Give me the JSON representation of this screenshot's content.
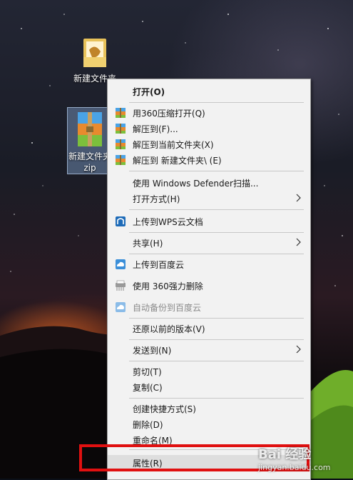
{
  "desktop": {
    "icons": [
      {
        "label": "新建文件夹",
        "icon": "folder-icon"
      },
      {
        "label": "新建文件夹",
        "label2": "zip",
        "icon": "winrar-archive-icon"
      }
    ]
  },
  "menu": {
    "items": [
      {
        "label": "打开(O)",
        "bold": true
      },
      {
        "label": "用360压缩打开(Q)",
        "icon": "archive-icon"
      },
      {
        "label": "解压到(F)...",
        "icon": "archive-icon"
      },
      {
        "label": "解压到当前文件夹(X)",
        "icon": "archive-icon"
      },
      {
        "label": "解压到 新建文件夹\\ (E)",
        "icon": "archive-icon"
      },
      {
        "label": "使用 Windows Defender扫描..."
      },
      {
        "label": "打开方式(H)",
        "submenu": true
      },
      {
        "label": "上传到WPS云文档",
        "icon": "wps-cloud-icon"
      },
      {
        "label": "共享(H)",
        "submenu": true
      },
      {
        "label": "上传到百度云",
        "icon": "baidu-cloud-icon"
      },
      {
        "label": "使用 360强力删除",
        "icon": "shredder-icon"
      },
      {
        "label": "自动备份到百度云",
        "icon": "baidu-cloud-icon",
        "disabled": true
      },
      {
        "label": "还原以前的版本(V)"
      },
      {
        "label": "发送到(N)",
        "submenu": true
      },
      {
        "label": "剪切(T)"
      },
      {
        "label": "复制(C)"
      },
      {
        "label": "创建快捷方式(S)"
      },
      {
        "label": "删除(D)"
      },
      {
        "label": "重命名(M)"
      },
      {
        "label": "属性(R)",
        "highlighted": true
      }
    ]
  },
  "watermark": {
    "text": "Bai 经验",
    "sub": "jingyan.baidu.com"
  },
  "colors": {
    "highlight": "#e01010",
    "menu_bg": "#f2f2f2"
  }
}
